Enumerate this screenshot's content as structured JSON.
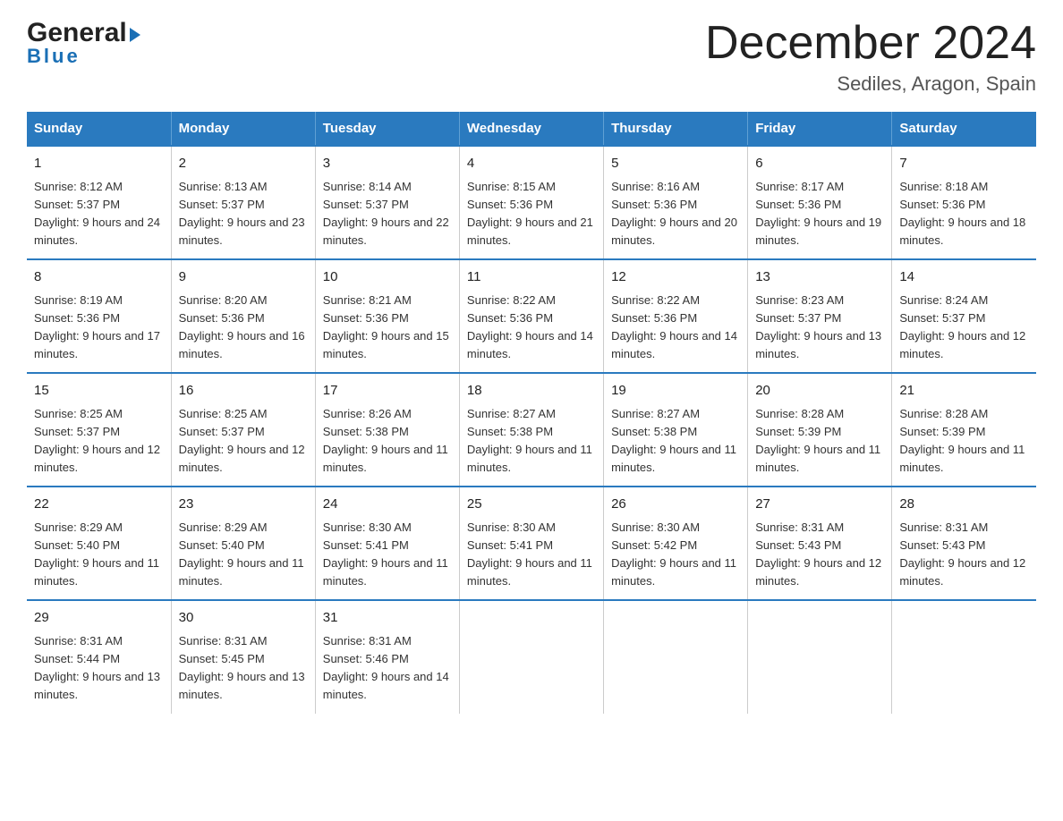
{
  "logo": {
    "general": "General",
    "blue": "Blue",
    "triangle": "▶"
  },
  "title": "December 2024",
  "subtitle": "Sediles, Aragon, Spain",
  "days_of_week": [
    "Sunday",
    "Monday",
    "Tuesday",
    "Wednesday",
    "Thursday",
    "Friday",
    "Saturday"
  ],
  "weeks": [
    [
      {
        "day": "1",
        "sunrise": "Sunrise: 8:12 AM",
        "sunset": "Sunset: 5:37 PM",
        "daylight": "Daylight: 9 hours and 24 minutes."
      },
      {
        "day": "2",
        "sunrise": "Sunrise: 8:13 AM",
        "sunset": "Sunset: 5:37 PM",
        "daylight": "Daylight: 9 hours and 23 minutes."
      },
      {
        "day": "3",
        "sunrise": "Sunrise: 8:14 AM",
        "sunset": "Sunset: 5:37 PM",
        "daylight": "Daylight: 9 hours and 22 minutes."
      },
      {
        "day": "4",
        "sunrise": "Sunrise: 8:15 AM",
        "sunset": "Sunset: 5:36 PM",
        "daylight": "Daylight: 9 hours and 21 minutes."
      },
      {
        "day": "5",
        "sunrise": "Sunrise: 8:16 AM",
        "sunset": "Sunset: 5:36 PM",
        "daylight": "Daylight: 9 hours and 20 minutes."
      },
      {
        "day": "6",
        "sunrise": "Sunrise: 8:17 AM",
        "sunset": "Sunset: 5:36 PM",
        "daylight": "Daylight: 9 hours and 19 minutes."
      },
      {
        "day": "7",
        "sunrise": "Sunrise: 8:18 AM",
        "sunset": "Sunset: 5:36 PM",
        "daylight": "Daylight: 9 hours and 18 minutes."
      }
    ],
    [
      {
        "day": "8",
        "sunrise": "Sunrise: 8:19 AM",
        "sunset": "Sunset: 5:36 PM",
        "daylight": "Daylight: 9 hours and 17 minutes."
      },
      {
        "day": "9",
        "sunrise": "Sunrise: 8:20 AM",
        "sunset": "Sunset: 5:36 PM",
        "daylight": "Daylight: 9 hours and 16 minutes."
      },
      {
        "day": "10",
        "sunrise": "Sunrise: 8:21 AM",
        "sunset": "Sunset: 5:36 PM",
        "daylight": "Daylight: 9 hours and 15 minutes."
      },
      {
        "day": "11",
        "sunrise": "Sunrise: 8:22 AM",
        "sunset": "Sunset: 5:36 PM",
        "daylight": "Daylight: 9 hours and 14 minutes."
      },
      {
        "day": "12",
        "sunrise": "Sunrise: 8:22 AM",
        "sunset": "Sunset: 5:36 PM",
        "daylight": "Daylight: 9 hours and 14 minutes."
      },
      {
        "day": "13",
        "sunrise": "Sunrise: 8:23 AM",
        "sunset": "Sunset: 5:37 PM",
        "daylight": "Daylight: 9 hours and 13 minutes."
      },
      {
        "day": "14",
        "sunrise": "Sunrise: 8:24 AM",
        "sunset": "Sunset: 5:37 PM",
        "daylight": "Daylight: 9 hours and 12 minutes."
      }
    ],
    [
      {
        "day": "15",
        "sunrise": "Sunrise: 8:25 AM",
        "sunset": "Sunset: 5:37 PM",
        "daylight": "Daylight: 9 hours and 12 minutes."
      },
      {
        "day": "16",
        "sunrise": "Sunrise: 8:25 AM",
        "sunset": "Sunset: 5:37 PM",
        "daylight": "Daylight: 9 hours and 12 minutes."
      },
      {
        "day": "17",
        "sunrise": "Sunrise: 8:26 AM",
        "sunset": "Sunset: 5:38 PM",
        "daylight": "Daylight: 9 hours and 11 minutes."
      },
      {
        "day": "18",
        "sunrise": "Sunrise: 8:27 AM",
        "sunset": "Sunset: 5:38 PM",
        "daylight": "Daylight: 9 hours and 11 minutes."
      },
      {
        "day": "19",
        "sunrise": "Sunrise: 8:27 AM",
        "sunset": "Sunset: 5:38 PM",
        "daylight": "Daylight: 9 hours and 11 minutes."
      },
      {
        "day": "20",
        "sunrise": "Sunrise: 8:28 AM",
        "sunset": "Sunset: 5:39 PM",
        "daylight": "Daylight: 9 hours and 11 minutes."
      },
      {
        "day": "21",
        "sunrise": "Sunrise: 8:28 AM",
        "sunset": "Sunset: 5:39 PM",
        "daylight": "Daylight: 9 hours and 11 minutes."
      }
    ],
    [
      {
        "day": "22",
        "sunrise": "Sunrise: 8:29 AM",
        "sunset": "Sunset: 5:40 PM",
        "daylight": "Daylight: 9 hours and 11 minutes."
      },
      {
        "day": "23",
        "sunrise": "Sunrise: 8:29 AM",
        "sunset": "Sunset: 5:40 PM",
        "daylight": "Daylight: 9 hours and 11 minutes."
      },
      {
        "day": "24",
        "sunrise": "Sunrise: 8:30 AM",
        "sunset": "Sunset: 5:41 PM",
        "daylight": "Daylight: 9 hours and 11 minutes."
      },
      {
        "day": "25",
        "sunrise": "Sunrise: 8:30 AM",
        "sunset": "Sunset: 5:41 PM",
        "daylight": "Daylight: 9 hours and 11 minutes."
      },
      {
        "day": "26",
        "sunrise": "Sunrise: 8:30 AM",
        "sunset": "Sunset: 5:42 PM",
        "daylight": "Daylight: 9 hours and 11 minutes."
      },
      {
        "day": "27",
        "sunrise": "Sunrise: 8:31 AM",
        "sunset": "Sunset: 5:43 PM",
        "daylight": "Daylight: 9 hours and 12 minutes."
      },
      {
        "day": "28",
        "sunrise": "Sunrise: 8:31 AM",
        "sunset": "Sunset: 5:43 PM",
        "daylight": "Daylight: 9 hours and 12 minutes."
      }
    ],
    [
      {
        "day": "29",
        "sunrise": "Sunrise: 8:31 AM",
        "sunset": "Sunset: 5:44 PM",
        "daylight": "Daylight: 9 hours and 13 minutes."
      },
      {
        "day": "30",
        "sunrise": "Sunrise: 8:31 AM",
        "sunset": "Sunset: 5:45 PM",
        "daylight": "Daylight: 9 hours and 13 minutes."
      },
      {
        "day": "31",
        "sunrise": "Sunrise: 8:31 AM",
        "sunset": "Sunset: 5:46 PM",
        "daylight": "Daylight: 9 hours and 14 minutes."
      },
      null,
      null,
      null,
      null
    ]
  ]
}
